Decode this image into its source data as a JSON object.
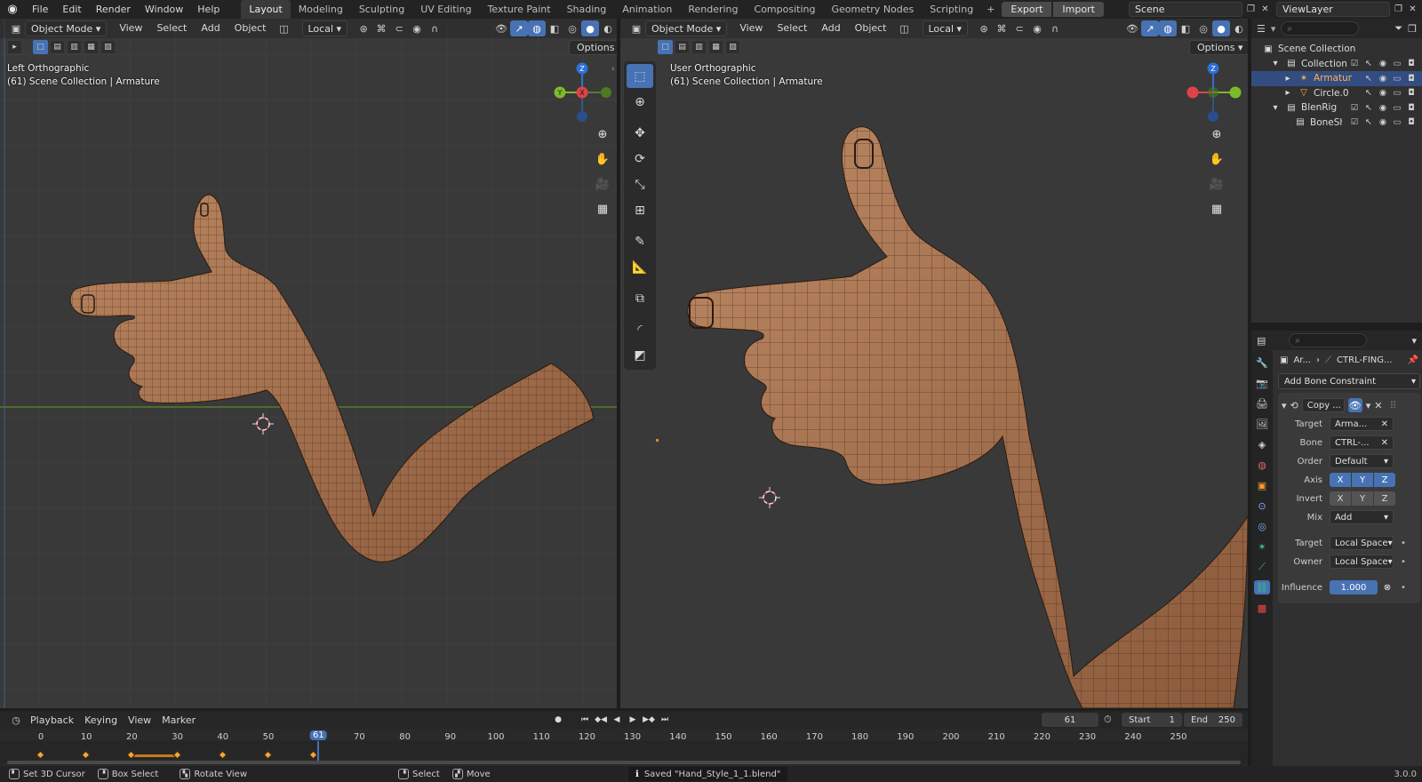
{
  "menu": [
    "File",
    "Edit",
    "Render",
    "Window",
    "Help"
  ],
  "workspaces": [
    "Layout",
    "Modeling",
    "Sculpting",
    "UV Editing",
    "Texture Paint",
    "Shading",
    "Animation",
    "Rendering",
    "Compositing",
    "Geometry Nodes",
    "Scripting"
  ],
  "active_workspace": "Layout",
  "buttons": {
    "export": "Export",
    "import": "Import"
  },
  "scene": "Scene",
  "view_layer": "ViewLayer",
  "viewport_left": {
    "mode": "Object Mode",
    "menus": [
      "View",
      "Select",
      "Add",
      "Object"
    ],
    "orientation": "Local",
    "options": "Options",
    "view_name": "Left Orthographic",
    "collection_info": "(61) Scene Collection | Armature"
  },
  "viewport_right": {
    "mode": "Object Mode",
    "menus": [
      "View",
      "Select",
      "Add",
      "Object"
    ],
    "orientation": "Local",
    "options": "Options",
    "view_name": "User Orthographic",
    "collection_info": "(61) Scene Collection | Armature"
  },
  "gizmo_labels": {
    "x": "X",
    "y": "Y",
    "z": "Z"
  },
  "outliner": {
    "rows": [
      {
        "name": "Scene Collection",
        "level": 0
      },
      {
        "name": "Collection",
        "level": 1
      },
      {
        "name": "Armatur",
        "level": 2
      },
      {
        "name": "Circle.0",
        "level": 2
      },
      {
        "name": "BlenRig",
        "level": 1
      },
      {
        "name": "BoneSha",
        "level": 2
      }
    ]
  },
  "properties": {
    "breadcrumb_object": "Ar...",
    "breadcrumb_bone": "CTRL-FING...",
    "add_constraint": "Add Bone Constraint",
    "constraint_name": "Copy ...",
    "target_label": "Target",
    "target_value": "Arma...",
    "bone_label": "Bone",
    "bone_value": "CTRL-...",
    "order_label": "Order",
    "order_value": "Default",
    "axis_label": "Axis",
    "invert_label": "Invert",
    "axes": [
      "X",
      "Y",
      "Z"
    ],
    "mix_label": "Mix",
    "mix_value": "Add",
    "target_space_label": "Target",
    "target_space_value": "Local Space",
    "owner_space_label": "Owner",
    "owner_space_value": "Local Space",
    "influence_label": "Influence",
    "influence_value": "1.000"
  },
  "timeline": {
    "menus": [
      "Playback",
      "Keying",
      "View",
      "Marker"
    ],
    "current_frame": "61",
    "start_label": "Start",
    "start_value": "1",
    "end_label": "End",
    "end_value": "250",
    "ticks": [
      "0",
      "10",
      "20",
      "30",
      "40",
      "50",
      "70",
      "80",
      "90",
      "100",
      "110",
      "120",
      "130",
      "140",
      "150",
      "160",
      "170",
      "180",
      "190",
      "200",
      "210",
      "220",
      "230",
      "240",
      "250"
    ],
    "keyframes": [
      0,
      10,
      20,
      30,
      40,
      50,
      60
    ]
  },
  "statusbar": {
    "set_cursor": "Set 3D Cursor",
    "box_select": "Box Select",
    "rotate_view": "Rotate View",
    "select": "Select",
    "move": "Move",
    "saved_message": "Saved \"Hand_Style_1_1.blend\"",
    "version": "3.0.0"
  },
  "colors": {
    "accent": "#4772b3",
    "skin": "#a8714c",
    "viewport_bg": "#393939",
    "keyframe": "#f2a630"
  }
}
